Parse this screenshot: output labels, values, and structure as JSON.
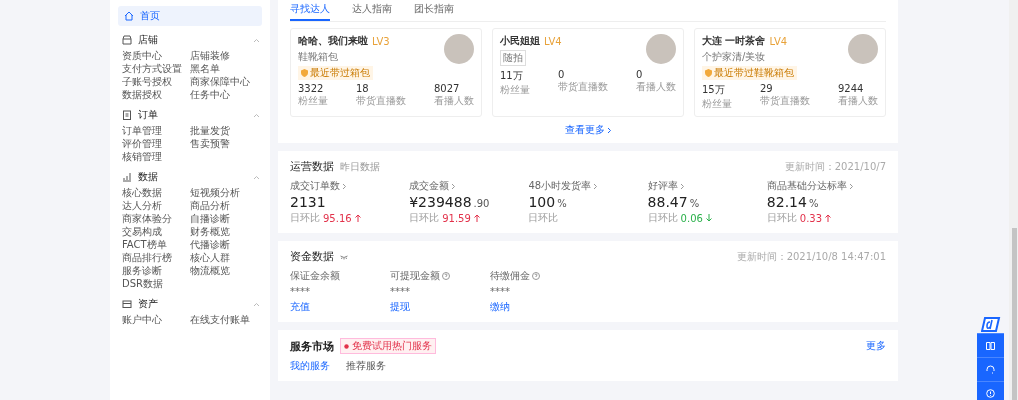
{
  "sidebar": {
    "home": {
      "label": "首页",
      "selected": true
    },
    "sections": [
      {
        "title": "店铺",
        "expanded": true,
        "items": [
          "资质中心",
          "店铺装修",
          "支付方式设置",
          "黑名单",
          "子账号授权",
          "商家保障中心",
          "数据授权",
          "任务中心"
        ]
      },
      {
        "title": "订单",
        "expanded": true,
        "items": [
          "订单管理",
          "批量发货",
          "评价管理",
          "售卖预警",
          "核销管理"
        ]
      },
      {
        "title": "数据",
        "expanded": true,
        "items": [
          "核心数据",
          "短视频分析",
          "达人分析",
          "商品分析",
          "商家体验分",
          "自播诊断",
          "交易构成",
          "财务概览",
          "FACT榜单",
          "代播诊断",
          "商品排行榜",
          "核心人群",
          "服务诊断",
          "物流概览",
          "DSR数据"
        ]
      },
      {
        "title": "资产",
        "expanded": true,
        "items": [
          "账户中心",
          "在线支付账单"
        ]
      }
    ]
  },
  "talent": {
    "tabs": [
      {
        "label": "寻找达人",
        "selected": true
      },
      {
        "label": "达人指南",
        "selected": false
      },
      {
        "label": "团长指南",
        "selected": false
      }
    ],
    "cards": [
      {
        "name": "哈哈、我们来啦",
        "level": "LV3",
        "category": "鞋靴箱包",
        "boxed": false,
        "badge": "最近带过箱包",
        "stats": [
          {
            "value": "3322",
            "label": "粉丝量"
          },
          {
            "value": "18",
            "label": "带货直播数"
          },
          {
            "value": "8027",
            "label": "看播人数"
          }
        ]
      },
      {
        "name": "小民姐姐",
        "level": "LV4",
        "category": "随拍",
        "boxed": true,
        "stats": [
          {
            "value": "11万",
            "label": "粉丝量"
          },
          {
            "value": "0",
            "label": "带货直播数"
          },
          {
            "value": "0",
            "label": "看播人数"
          }
        ]
      },
      {
        "name": "大连 一时茶舍",
        "level": "LV4",
        "category": "个护家清/美妆",
        "boxed": false,
        "badge": "最近带过鞋靴箱包",
        "stats": [
          {
            "value": "15万",
            "label": "粉丝量"
          },
          {
            "value": "29",
            "label": "带货直播数"
          },
          {
            "value": "9244",
            "label": "看播人数"
          }
        ]
      }
    ],
    "more": "查看更多"
  },
  "operations": {
    "title": "运营数据",
    "subtitle": "昨日数据",
    "updated": "更新时间：2021/10/7",
    "metrics": [
      {
        "label": "成交订单数",
        "value": "2131",
        "compare_label": "日环比",
        "compare": "95.16",
        "rising": true
      },
      {
        "label": "成交金额",
        "value": "¥239488",
        "decimal": ".90",
        "compare_label": "日环比",
        "compare": "91.59",
        "rising": true
      },
      {
        "label": "48小时发货率",
        "value": "100",
        "unit": "%",
        "compare_label": "日环比"
      },
      {
        "label": "好评率",
        "value": "88.47",
        "unit": "%",
        "compare_label": "日环比",
        "compare": "0.06",
        "rising": false
      },
      {
        "label": "商品基础分达标率",
        "value": "82.14",
        "unit": "%",
        "compare_label": "日环比",
        "compare": "0.33",
        "rising": true
      }
    ]
  },
  "funds": {
    "title": "资金数据",
    "hidden": true,
    "updated": "更新时间：2021/10/8 14:47:01",
    "columns": [
      {
        "label": "保证金余额",
        "help": false,
        "value": "****",
        "action": "充值"
      },
      {
        "label": "可提现金额",
        "help": true,
        "value": "****",
        "action": "提现"
      },
      {
        "label": "待缴佣金",
        "help": true,
        "value": "****",
        "action": "缴纳"
      }
    ]
  },
  "services": {
    "title": "服务市场",
    "promo": "免费试用热门服务",
    "more": "更多",
    "tabs": [
      {
        "label": "我的服务",
        "selected": true
      },
      {
        "label": "推荐服务",
        "selected": false
      }
    ]
  }
}
